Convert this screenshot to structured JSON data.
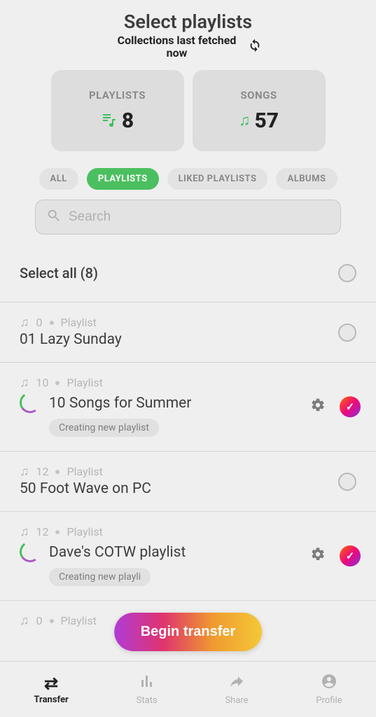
{
  "header": {
    "title": "Select playlists",
    "subtitle": "Collections last fetched now"
  },
  "stats": {
    "playlists": {
      "label": "PLAYLISTS",
      "value": "8"
    },
    "songs": {
      "label": "SONGS",
      "value": "57"
    }
  },
  "filters": {
    "all": "ALL",
    "playlists": "PLAYLISTS",
    "liked": "LIKED PLAYLISTS",
    "albums": "ALBUMS",
    "active": "playlists"
  },
  "search": {
    "placeholder": "Search"
  },
  "selectAll": {
    "label": "Select all (8)"
  },
  "rows": [
    {
      "count": "0",
      "type": "Playlist",
      "title": "01 Lazy Sunday",
      "selected": false,
      "creating": false
    },
    {
      "count": "10",
      "type": "Playlist",
      "title": "10 Songs for Summer",
      "selected": true,
      "creating": true,
      "status": "Creating new playlist"
    },
    {
      "count": "12",
      "type": "Playlist",
      "title": "50 Foot Wave on PC",
      "selected": false,
      "creating": false
    },
    {
      "count": "12",
      "type": "Playlist",
      "title": "Dave's COTW playlist",
      "selected": true,
      "creating": true,
      "status": "Creating new playli"
    },
    {
      "count": "0",
      "type": "Playlist",
      "title": "",
      "selected": false,
      "creating": false
    }
  ],
  "cta": {
    "label": "Begin transfer"
  },
  "tabs": {
    "transfer": "Transfer",
    "stats": "Stats",
    "share": "Share",
    "profile": "Profile"
  }
}
